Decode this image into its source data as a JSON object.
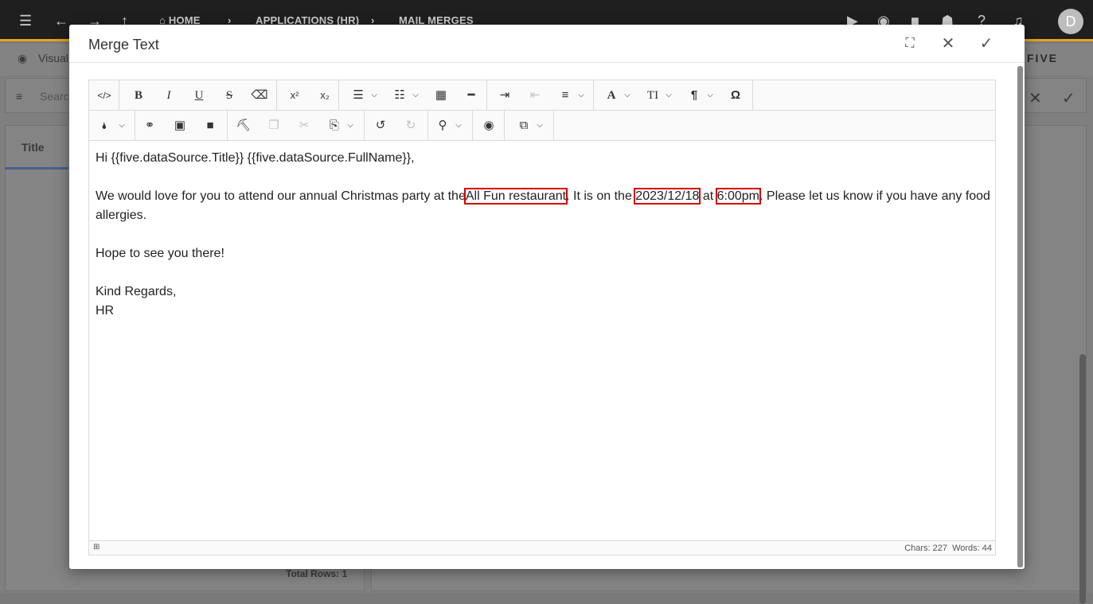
{
  "app": {
    "breadcrumbs": [
      "HOME",
      "APPLICATIONS (HR)",
      "MAIL MERGES"
    ],
    "avatar": "D",
    "brand": "FIVE"
  },
  "background": {
    "view_label": "Visual",
    "search_placeholder": "Search",
    "column_title": "Title",
    "total_rows": "Total Rows: 1"
  },
  "modal": {
    "title": "Merge Text"
  },
  "toolbar": {
    "row1": [
      {
        "name": "code-view-icon",
        "glyph": "</>"
      },
      {
        "name": "bold-icon",
        "glyph": "B"
      },
      {
        "name": "italic-icon",
        "glyph": "I"
      },
      {
        "name": "underline-icon",
        "glyph": "U"
      },
      {
        "name": "strikethrough-icon",
        "glyph": "S"
      },
      {
        "name": "clear-format-icon",
        "glyph": "⌫"
      },
      {
        "name": "superscript-icon",
        "glyph": "x²"
      },
      {
        "name": "subscript-icon",
        "glyph": "x₂"
      },
      {
        "name": "bullet-list-icon",
        "glyph": "☰"
      },
      {
        "name": "numbered-list-icon",
        "glyph": "☰"
      },
      {
        "name": "table-icon",
        "glyph": "▦"
      },
      {
        "name": "horizontal-rule-icon",
        "glyph": "━"
      },
      {
        "name": "indent-icon",
        "glyph": "⇥"
      },
      {
        "name": "outdent-icon",
        "glyph": "⇤"
      },
      {
        "name": "align-icon",
        "glyph": "≡"
      },
      {
        "name": "font-icon",
        "glyph": "A"
      },
      {
        "name": "font-size-icon",
        "glyph": "TI"
      },
      {
        "name": "paragraph-icon",
        "glyph": "¶"
      },
      {
        "name": "special-char-icon",
        "glyph": "Ω"
      }
    ],
    "row2": [
      {
        "name": "color-icon",
        "glyph": "●"
      },
      {
        "name": "link-icon",
        "glyph": "🔗"
      },
      {
        "name": "image-icon",
        "glyph": "▣"
      },
      {
        "name": "video-icon",
        "glyph": "■"
      },
      {
        "name": "format-painter-icon",
        "glyph": "▬"
      },
      {
        "name": "copy-icon",
        "glyph": "❐"
      },
      {
        "name": "cut-icon",
        "glyph": "✂"
      },
      {
        "name": "paste-icon",
        "glyph": "⎘"
      },
      {
        "name": "undo-icon",
        "glyph": "↺"
      },
      {
        "name": "redo-icon",
        "glyph": "↻"
      },
      {
        "name": "find-icon",
        "glyph": "⚲"
      },
      {
        "name": "preview-icon",
        "glyph": "◉"
      },
      {
        "name": "select-all-icon",
        "glyph": "⧉"
      }
    ]
  },
  "content": {
    "greeting": "Hi {{five.dataSource.Title}} {{five.dataSource.FullName}},",
    "p1_a": "We would love for you to attend our annual Christmas party at the",
    "venue": "All Fun restaurant",
    "p1_b": ". It is on the",
    "date": "2023/12/18",
    "p1_c": "at",
    "time": "6:00pm",
    "p1_d": ". Please let us know if you have any food allergies.",
    "hope": "Hope to see you there!",
    "regards": "Kind Regards,",
    "sign": "HR"
  },
  "status": {
    "chars": "Chars: 227",
    "words": "Words: 44"
  },
  "colors": {
    "accent": "#e6a21a",
    "highlight": "#d40000"
  }
}
